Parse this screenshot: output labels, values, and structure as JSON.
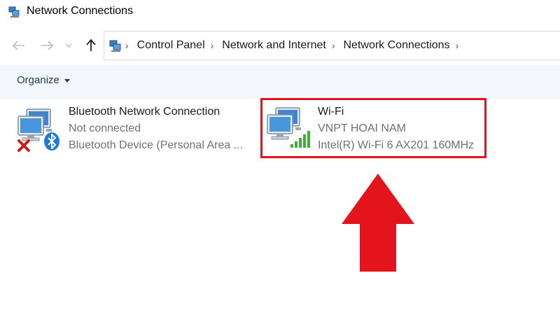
{
  "window": {
    "title": "Network Connections"
  },
  "nav": {
    "back_icon": "back-arrow-icon",
    "forward_icon": "forward-arrow-icon",
    "history_icon": "chevron-down-icon",
    "up_icon": "up-arrow-icon",
    "breadcrumbs": [
      "Control Panel",
      "Network and Internet",
      "Network Connections"
    ]
  },
  "toolbar": {
    "organize_label": "Organize"
  },
  "connections": [
    {
      "name": "Bluetooth Network Connection",
      "status": "Not connected",
      "device": "Bluetooth Device (Personal Area ...",
      "icon": "network-computers-icon",
      "badges": [
        "red-x-icon",
        "bluetooth-icon"
      ]
    },
    {
      "name": "Wi-Fi",
      "status": "VNPT HOAI NAM",
      "device": "Intel(R) Wi-Fi 6 AX201 160MHz",
      "icon": "network-computers-icon",
      "badges": [
        "wifi-signal-icon"
      ]
    }
  ],
  "colors": {
    "highlight": "#e0141e",
    "arrow": "#e3141c",
    "toolbar_bg": "#f3f6fa",
    "signal": "#3fae3a",
    "bluetooth": "#1f79d6"
  }
}
